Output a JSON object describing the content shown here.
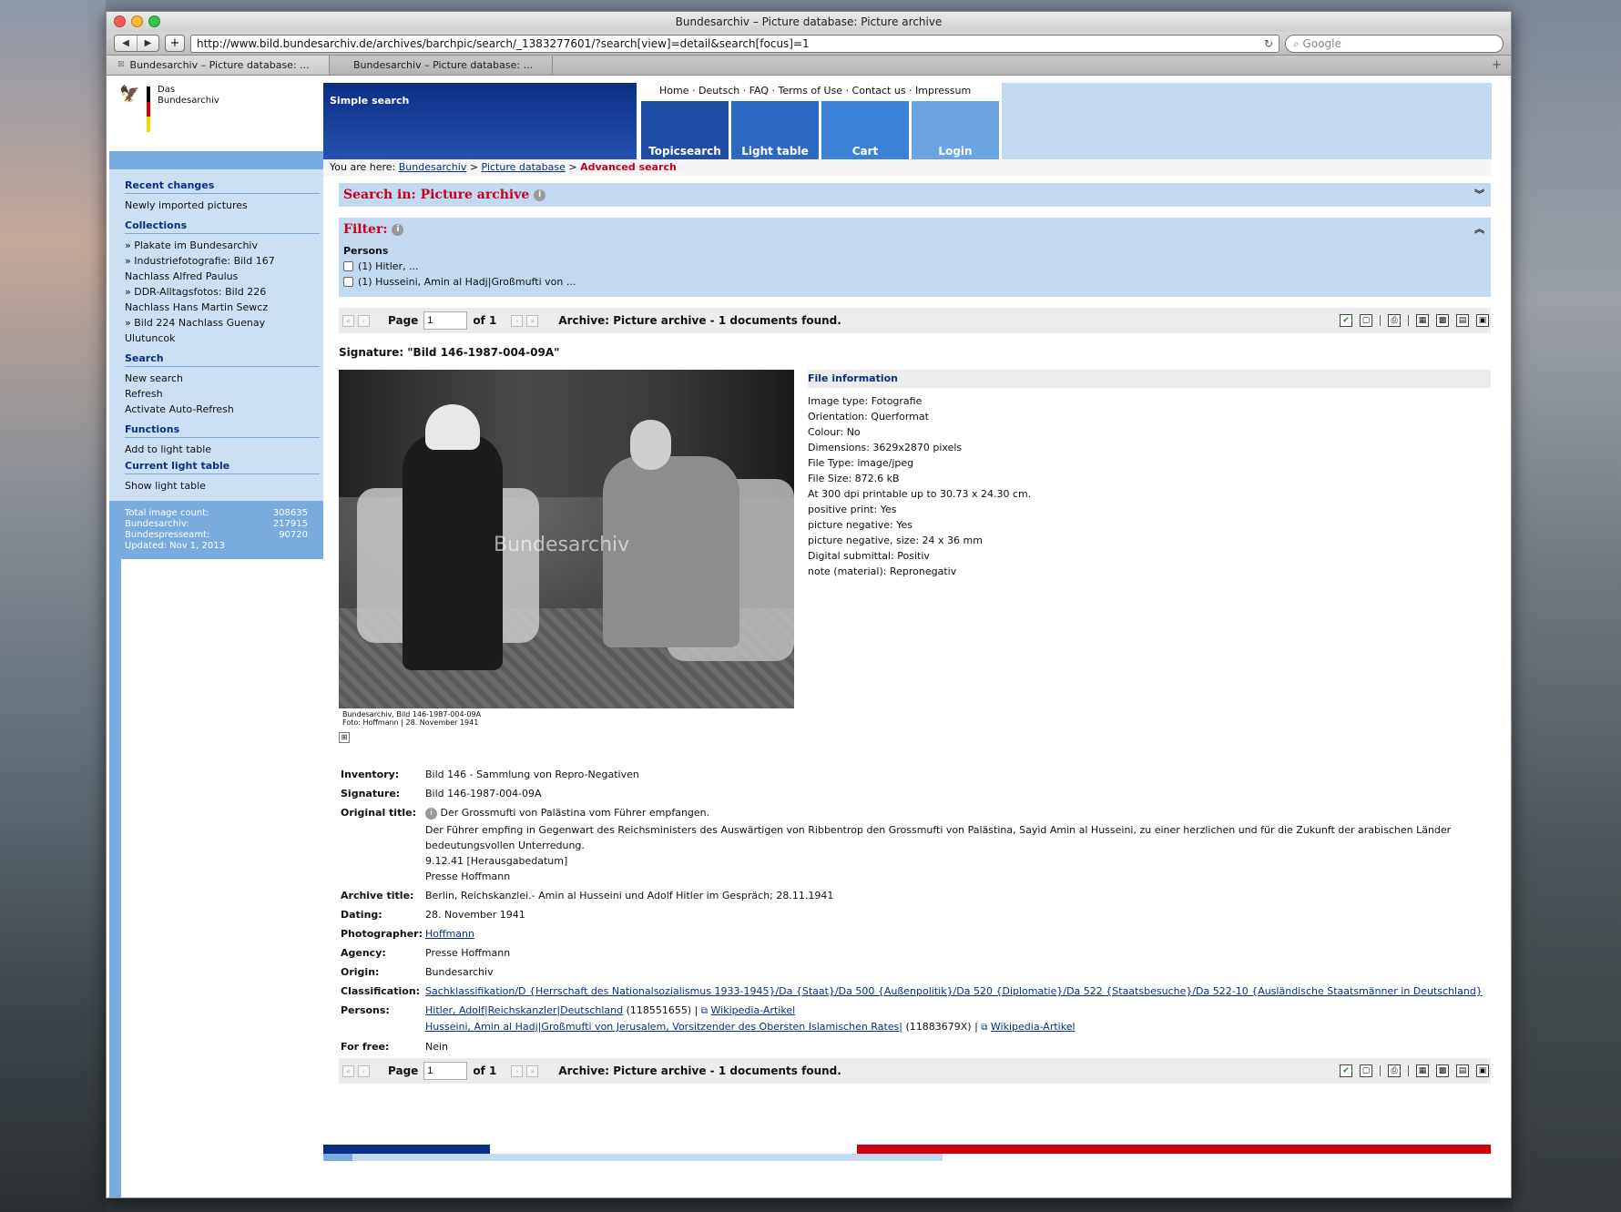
{
  "browser": {
    "window_title": "Bundesarchiv – Picture database: Picture archive",
    "url": "http://www.bild.bundesarchiv.de/archives/barchpic/search/_1383277601/?search[view]=detail&search[focus]=1",
    "search_placeholder": "Google",
    "tabs": [
      {
        "label": "Bundesarchiv – Picture database: ..."
      },
      {
        "label": "Bundesarchiv – Picture database: ..."
      }
    ]
  },
  "logo": {
    "line1": "Das",
    "line2": "Bundesarchiv",
    "flag_colors": [
      "#000000",
      "#dd0000",
      "#ffce00"
    ]
  },
  "top_nav": {
    "simple_search": "Simple search",
    "links": "Home · Deutsch · FAQ · Terms of Use · Contact us · Impressum",
    "blocks": [
      "Topicsearch",
      "Light table",
      "Cart",
      "Login"
    ]
  },
  "breadcrumb": {
    "prefix": "You are here:",
    "items": [
      "Bundesarchiv",
      "Picture database"
    ],
    "current": "Advanced search",
    "sep": ">"
  },
  "sidebar": {
    "sections": [
      {
        "head": "Recent changes",
        "items": [
          "Newly imported pictures"
        ]
      },
      {
        "head": "Collections",
        "items": [
          "» Plakate im Bundesarchiv",
          "» Industriefotografie: Bild 167",
          "Nachlass Alfred Paulus",
          "» DDR-Alltagsfotos: Bild 226",
          "Nachlass Hans Martin Sewcz",
          "» Bild 224 Nachlass Guenay",
          "Ulutuncok"
        ]
      },
      {
        "head": "Search",
        "items": [
          "New search",
          "Refresh",
          "Activate Auto-Refresh"
        ]
      },
      {
        "head": "Functions",
        "items": [
          "Add to light table"
        ]
      },
      {
        "head": "Current light table",
        "items": [
          "Show light table"
        ]
      }
    ],
    "stats": [
      {
        "label": "Total image count:",
        "value": "308635"
      },
      {
        "label": "Bundesarchiv:",
        "value": "217915"
      },
      {
        "label": "Bundespresseamt:",
        "value": "90720"
      },
      {
        "label": "Updated: Nov 1, 2013",
        "value": ""
      }
    ]
  },
  "search_in": {
    "title": "Search in: Picture archive"
  },
  "filter": {
    "title": "Filter:",
    "group": "Persons",
    "options": [
      "(1) Hitler, ...",
      "(1) Husseini, Amin al Hadj|Großmufti von ..."
    ]
  },
  "pager": {
    "page_label": "Page",
    "page_value": "1",
    "of_label": "of 1",
    "summary": "Archive: Picture archive - 1 documents found."
  },
  "signature_heading": "Signature: \"Bild 146-1987-004-09A\"",
  "photo": {
    "watermark": "Bundesarchiv",
    "caption1": "Bundesarchiv, Bild 146-1987-004-09A",
    "caption2": "Foto: Hoffmann | 28. November 1941"
  },
  "file_info": {
    "head": "File information",
    "lines": [
      "Image type: Fotografie",
      "Orientation: Querformat",
      "Colour: No",
      "Dimensions: 3629x2870 pixels",
      "File Type: image/jpeg",
      "File Size: 872.6 kB",
      "At 300 dpi printable up to 30.73 x 24.30 cm.",
      "positive print: Yes",
      "picture negative: Yes",
      "picture negative, size: 24 x 36 mm",
      "Digital submittal: Positiv",
      "note (material): Repronegativ"
    ]
  },
  "meta": {
    "inventory": {
      "label": "Inventory:",
      "value": "Bild 146 - Sammlung von Repro-Negativen"
    },
    "signature": {
      "label": "Signature:",
      "value": "Bild 146-1987-004-09A"
    },
    "original_title": {
      "label": "Original title:",
      "line1": "Der Grossmufti von Palästina vom Führer empfangen.",
      "line2": "Der Führer empfing in Gegenwart des Reichsministers des Auswärtigen von Ribbentrop den Grossmufti von Palästina, Sayid Amin al Husseini, zu einer herzlichen und für die Zukunft der arabischen Länder bedeutungsvollen Unterredung.",
      "line3": "9.12.41 [Herausgabedatum]",
      "line4": "Presse Hoffmann"
    },
    "archive_title": {
      "label": "Archive title:",
      "value": "Berlin, Reichskanzlei.- Amin al Husseini und Adolf Hitler im Gespräch; 28.11.1941"
    },
    "dating": {
      "label": "Dating:",
      "value": "28. November 1941"
    },
    "photographer": {
      "label": "Photographer:",
      "value": "Hoffmann"
    },
    "agency": {
      "label": "Agency:",
      "value": "Presse Hoffmann"
    },
    "origin": {
      "label": "Origin:",
      "value": "Bundesarchiv"
    },
    "classification": {
      "label": "Classification:",
      "value": "Sachklassifikation/D {Herrschaft des Nationalsozialismus 1933-1945}/Da {Staat}/Da 500 {Außenpolitik}/Da 520 {Diplomatie}/Da 522 {Staatsbesuche}/Da 522-10 {Ausländische Staatsmänner in Deutschland}"
    },
    "persons": {
      "label": "Persons:",
      "p1_name": "Hitler, Adolf|Reichskanzler|Deutschland",
      "p1_id": "(118551655) |",
      "p2_name": "Husseini, Amin al Hadj|Großmufti von Jerusalem, Vorsitzender des Obersten Islamischen Rates|",
      "p2_id": "(11883679X) |",
      "wiki": "Wikipedia-Artikel"
    },
    "for_free": {
      "label": "For free:",
      "value": "Nein"
    }
  }
}
